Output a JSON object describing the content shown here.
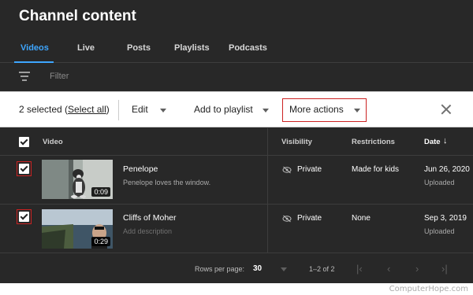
{
  "header": {
    "title": "Channel content"
  },
  "tabs": [
    {
      "label": "Videos",
      "active": true
    },
    {
      "label": "Live"
    },
    {
      "label": "Posts"
    },
    {
      "label": "Playlists"
    },
    {
      "label": "Podcasts"
    }
  ],
  "filter": {
    "icon": "filter-lines-icon",
    "placeholder": "Filter"
  },
  "action_bar": {
    "selected_text": "2 selected (",
    "select_all": "Select all",
    "selected_close": ")",
    "edit": "Edit",
    "add_to_playlist": "Add to playlist",
    "more_actions": "More actions"
  },
  "table": {
    "headers": {
      "video": "Video",
      "visibility": "Visibility",
      "restrictions": "Restrictions",
      "date": "Date",
      "date_sort_arrow": "↓"
    },
    "rows": [
      {
        "checked": true,
        "title": "Penelope",
        "description": "Penelope loves the window.",
        "duration": "0:09",
        "visibility": "Private",
        "restrictions": "Made for kids",
        "date": "Jun 26, 2020",
        "date_status": "Uploaded"
      },
      {
        "checked": true,
        "title": "Cliffs of Moher",
        "description": "Add description",
        "duration": "0:29",
        "visibility": "Private",
        "restrictions": "None",
        "date": "Sep 3, 2019",
        "date_status": "Uploaded"
      }
    ]
  },
  "footer": {
    "rows_per_page_label": "Rows per page:",
    "rows_per_page_value": "30",
    "range": "1–2 of 2",
    "first_page": "|‹",
    "prev_page": "‹",
    "next_page": "›",
    "last_page": "›|"
  },
  "credit": "ComputerHope.com",
  "colors": {
    "accent": "#3ea6ff",
    "background": "#282828",
    "highlight": "#cc2222"
  }
}
